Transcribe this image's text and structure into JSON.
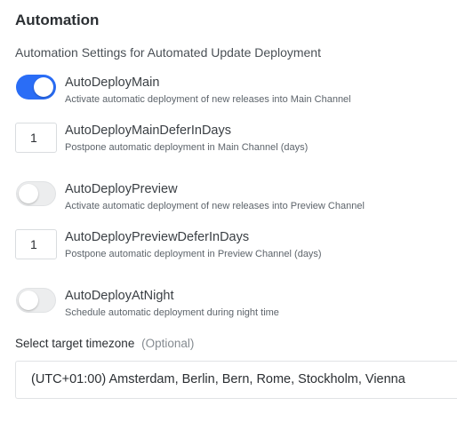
{
  "section": {
    "title": "Automation",
    "subtitle": "Automation Settings for Automated Update Deployment"
  },
  "settings": [
    {
      "type": "toggle",
      "checked": true,
      "label": "AutoDeployMain",
      "description": "Activate automatic deployment of new releases into Main Channel"
    },
    {
      "type": "number",
      "value": "1",
      "label": "AutoDeployMainDeferInDays",
      "description": "Postpone automatic deployment in Main Channel (days)"
    },
    {
      "type": "toggle",
      "checked": false,
      "label": "AutoDeployPreview",
      "description": "Activate automatic deployment of new releases into Preview Channel"
    },
    {
      "type": "number",
      "value": "1",
      "label": "AutoDeployPreviewDeferInDays",
      "description": "Postpone automatic deployment in Preview Channel (days)"
    },
    {
      "type": "toggle",
      "checked": false,
      "label": "AutoDeployAtNight",
      "description": "Schedule automatic deployment during night time"
    }
  ],
  "timezone": {
    "label": "Select target timezone",
    "optional": "(Optional)",
    "selected": "(UTC+01:00) Amsterdam, Berlin, Bern, Rome, Stockholm, Vienna"
  },
  "colors": {
    "toggle_on": "#2a6df6",
    "toggle_off": "#ecedee"
  }
}
